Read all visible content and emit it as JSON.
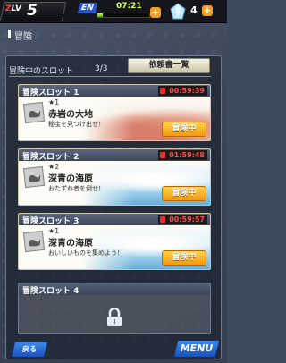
{
  "status_bar": {
    "lv_prefix": "Z",
    "lv_label": "LV",
    "level": "5",
    "en_label": "EN",
    "en_time": "07:21",
    "en_fill_fraction": 0.1,
    "gem_count": "4",
    "plus_symbol": "+"
  },
  "header": {
    "title": "冒険"
  },
  "panel": {
    "heading": "冒険中のスロット",
    "count": "3/3",
    "request_button": "依頼書一覧"
  },
  "slots": [
    {
      "title": "冒険スロット 1",
      "timer": "00:59:39",
      "stars": "★1",
      "place": "赤岩の大地",
      "mission": "秘宝を見つけ出せ！",
      "status": "冒険中",
      "theme": "red"
    },
    {
      "title": "冒険スロット 2",
      "timer": "01:59:48",
      "stars": "★2",
      "place": "深青の海原",
      "mission": "おたずね者を倒せ！",
      "status": "冒険中",
      "theme": "blue"
    },
    {
      "title": "冒険スロット 3",
      "timer": "00:59:57",
      "stars": "★1",
      "place": "深青の海原",
      "mission": "おいしいものを集めよう！",
      "status": "冒険中",
      "theme": "blue"
    },
    {
      "title": "冒険スロット 4",
      "locked": true
    }
  ],
  "footer": {
    "back_label": "戻る",
    "menu_label": "MENU"
  },
  "colors": {
    "timer_text": "#ff4a4a",
    "status_button": "#f29a12",
    "energy_bar": "#8ee01a"
  }
}
